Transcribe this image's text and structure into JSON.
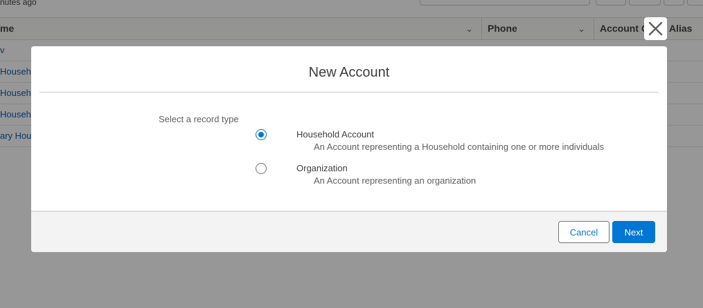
{
  "background": {
    "updated_text": "nutes ago",
    "columns": {
      "name": "me",
      "phone": "Phone",
      "account_owner": "Account O",
      "alias": "Alias"
    },
    "rows": [
      "v",
      "Househo",
      "Househo",
      "Househo",
      "ary Hous"
    ]
  },
  "modal": {
    "title": "New Account",
    "record_type_label": "Select a record type",
    "options": [
      {
        "label": "Household Account",
        "description": "An Account representing a Household containing one or more individuals",
        "selected": true
      },
      {
        "label": "Organization",
        "description": "An Account representing an organization",
        "selected": false
      }
    ],
    "cancel_label": "Cancel",
    "next_label": "Next",
    "close_icon": "close-icon"
  },
  "colors": {
    "brand": "#0176d3",
    "link": "#0b5cab",
    "overlay": "#808080"
  }
}
